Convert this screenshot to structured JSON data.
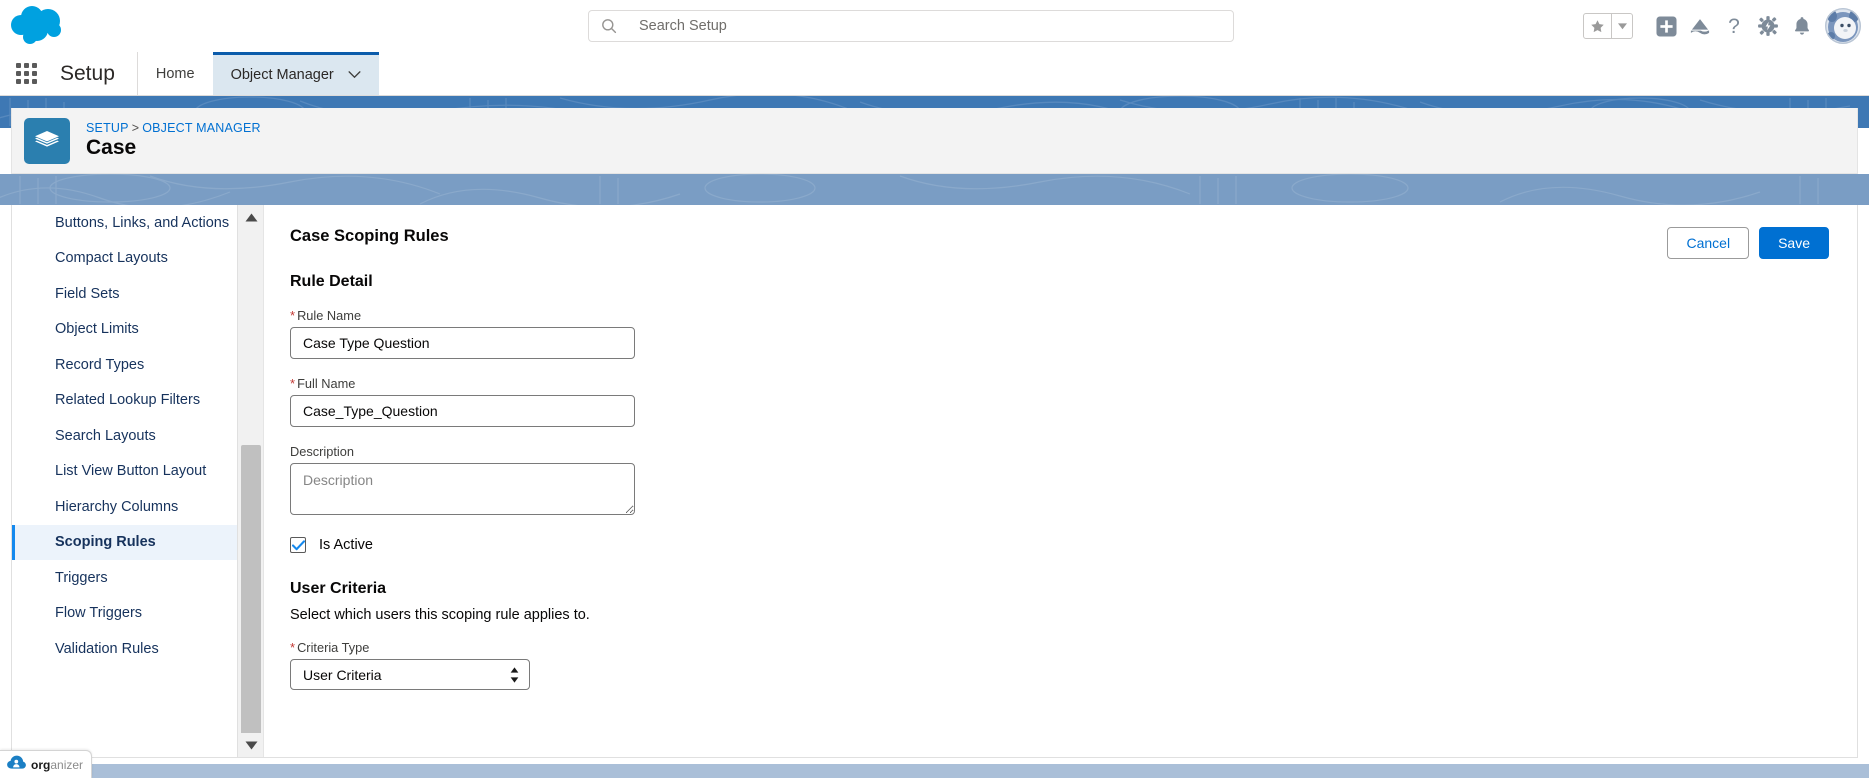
{
  "header": {
    "logo_icon": "salesforce-cloud-logo",
    "search": {
      "placeholder": "Search Setup",
      "value": "",
      "icon": "search-icon"
    },
    "icons": [
      {
        "name": "favorites-star-icon",
        "label": "Favorites"
      },
      {
        "name": "favorites-dropdown-caret-icon",
        "label": "Favorites list"
      },
      {
        "name": "global-actions-plus-icon",
        "label": "Global Actions"
      },
      {
        "name": "trailhead-icon",
        "label": "Trailhead"
      },
      {
        "name": "help-question-icon",
        "label": "Help"
      },
      {
        "name": "setup-gear-icon",
        "label": "Setup"
      },
      {
        "name": "notifications-bell-icon",
        "label": "Notifications"
      },
      {
        "name": "user-avatar",
        "label": "View profile"
      }
    ]
  },
  "setup_nav": {
    "app_launcher_icon": "app-launcher-waffle-icon",
    "app_name": "Setup",
    "tabs": [
      {
        "label": "Home",
        "active": false,
        "has_caret": false
      },
      {
        "label": "Object Manager",
        "active": true,
        "has_caret": true
      }
    ]
  },
  "record_header": {
    "object_icon": "standard-object-layers-icon",
    "breadcrumb": {
      "root": "SETUP",
      "separator": ">",
      "current": "OBJECT MANAGER"
    },
    "title": "Case"
  },
  "sidebar": {
    "items": [
      {
        "label": "Buttons, Links, and Actions",
        "active": false
      },
      {
        "label": "Compact Layouts",
        "active": false
      },
      {
        "label": "Field Sets",
        "active": false
      },
      {
        "label": "Object Limits",
        "active": false
      },
      {
        "label": "Record Types",
        "active": false
      },
      {
        "label": "Related Lookup Filters",
        "active": false
      },
      {
        "label": "Search Layouts",
        "active": false
      },
      {
        "label": "List View Button Layout",
        "active": false
      },
      {
        "label": "Hierarchy Columns",
        "active": false
      },
      {
        "label": "Scoping Rules",
        "active": true
      },
      {
        "label": "Triggers",
        "active": false
      },
      {
        "label": "Flow Triggers",
        "active": false
      },
      {
        "label": "Validation Rules",
        "active": false
      }
    ],
    "scrollbar": {
      "up_arrow_icon": "scroll-up-arrow-icon",
      "down_arrow_icon": "scroll-down-arrow-icon"
    }
  },
  "main": {
    "title": "Case Scoping Rules",
    "actions": {
      "cancel_label": "Cancel",
      "save_label": "Save"
    },
    "rule_detail": {
      "heading": "Rule Detail",
      "rule_name": {
        "label": "Rule Name",
        "required": true,
        "value": "Case Type Question"
      },
      "full_name": {
        "label": "Full Name",
        "required": true,
        "value": "Case_Type_Question"
      },
      "description": {
        "label": "Description",
        "required": false,
        "value": "",
        "placeholder": "Description"
      },
      "is_active": {
        "label": "Is Active",
        "checked": true,
        "checkmark_icon": "check-icon"
      }
    },
    "user_criteria": {
      "heading": "User Criteria",
      "description": "Select which users this scoping rule applies to.",
      "criteria_type": {
        "label": "Criteria Type",
        "required": true,
        "value": "User Criteria",
        "options": [
          "User Criteria"
        ]
      }
    }
  },
  "organizer_badge": {
    "icon": "organizer-cloud-icon",
    "bold_text": "org",
    "light_text": "anizer"
  },
  "colors": {
    "brand_blue": "#0070d2",
    "link_blue": "#0070d2",
    "band_blue": "#3e78b4",
    "band_blue_light": "#7a9dc4",
    "bottom_band": "#aabfd8",
    "object_icon_blue": "#2b7faf",
    "active_nav_bg": "#ecf3fb",
    "active_nav_border": "#1589ee",
    "required_red": "#c23934",
    "tab_active_bg": "#dbe7f0",
    "tab_active_border": "#0b5cab"
  }
}
